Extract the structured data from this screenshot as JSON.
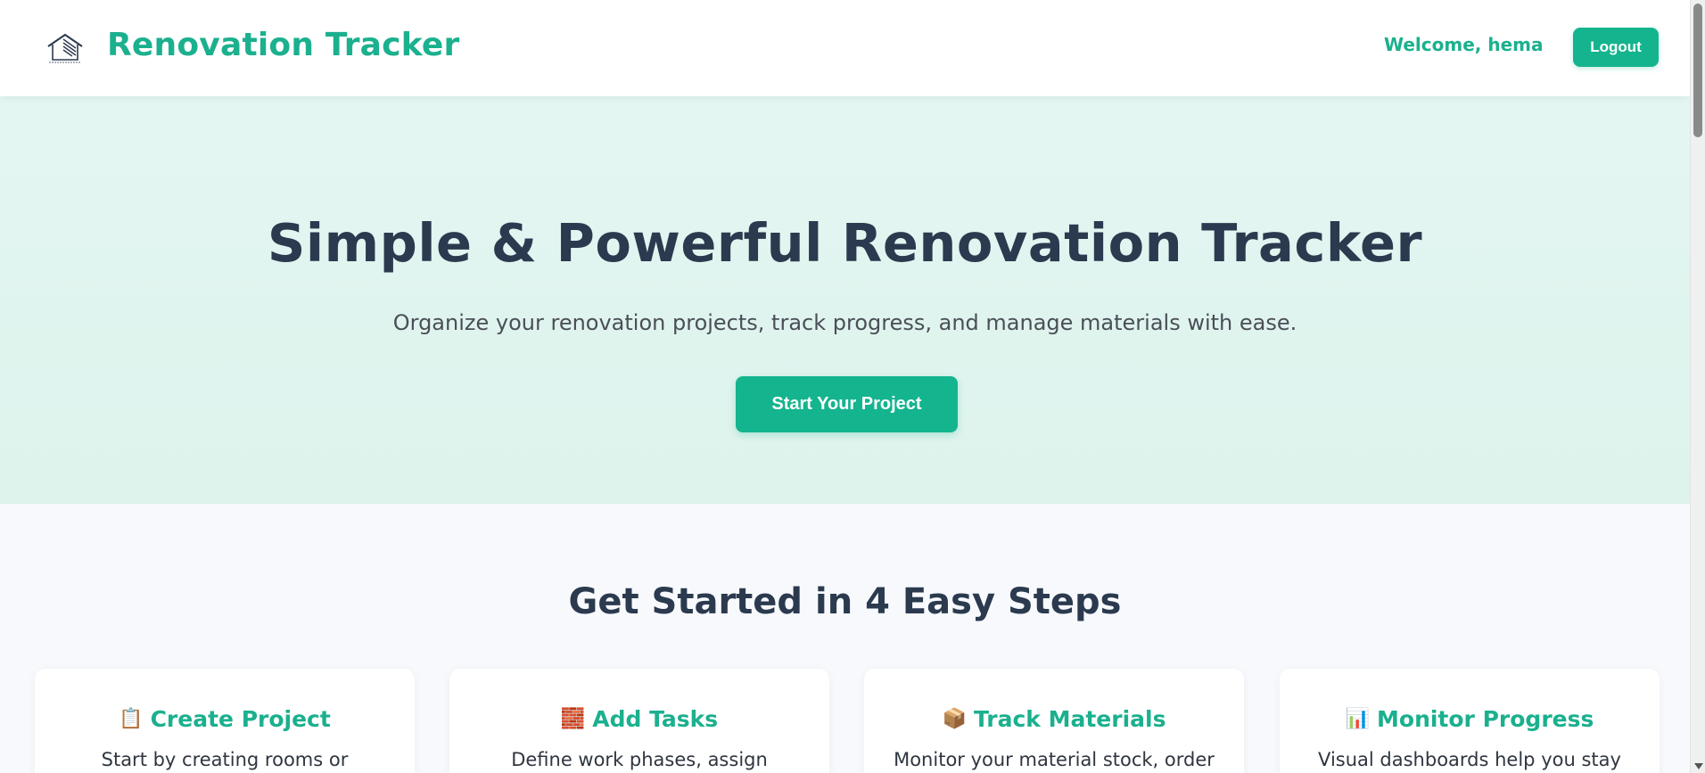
{
  "header": {
    "brand": "Renovation Tracker",
    "welcome": "Welcome, hema",
    "logout_label": "Logout",
    "logo_icon": "house-logo-icon"
  },
  "hero": {
    "title": "Simple & Powerful Renovation Tracker",
    "subtitle": "Organize your renovation projects, track progress, and manage materials with ease.",
    "cta_label": "Start Your Project"
  },
  "steps": {
    "title": "Get Started in 4 Easy Steps",
    "cards": [
      {
        "icon": "📋",
        "icon_name": "clipboard-icon",
        "title": "Create Project",
        "desc": "Start by creating rooms or"
      },
      {
        "icon": "🧱",
        "icon_name": "brick-icon",
        "title": "Add Tasks",
        "desc": "Define work phases, assign"
      },
      {
        "icon": "📦",
        "icon_name": "package-icon",
        "title": "Track Materials",
        "desc": "Monitor your material stock, order"
      },
      {
        "icon": "📊",
        "icon_name": "bar-chart-icon",
        "title": "Monitor Progress",
        "desc": "Visual dashboards help you stay"
      }
    ]
  },
  "colors": {
    "accent": "#14b48e",
    "brand_text": "#1bb08e",
    "heading": "#2b3a4e",
    "hero_bg": "#e4f6f2",
    "page_bg": "#f7f9fc"
  }
}
